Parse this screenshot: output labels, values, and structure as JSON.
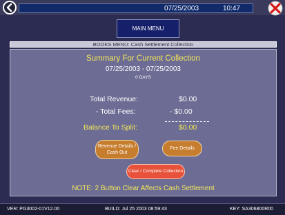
{
  "header": {
    "date": "07/25/2003",
    "time": "10:47"
  },
  "menu": {
    "main_menu_label": "MAIN MENU",
    "books_menu_label": "BOOKS MENU: Cash Settlement Collection"
  },
  "summary": {
    "title": "Summary For Current Collection",
    "date_range": "07/25/2003 - 07/25/2003",
    "days": "0 DAYS",
    "total_revenue_label": "Total Revenue:",
    "total_revenue_value": "$0.00",
    "total_fees_label": "- Total Fees:",
    "total_fees_value": "- $0.00",
    "balance_label": "Balance To Split:",
    "balance_value": "$0.00"
  },
  "buttons": {
    "revenue_details_line1": "Revenue Details /",
    "revenue_details_line2": "Cash Out",
    "fee_details": "Fee Details",
    "clear_collection": "Clear / Complete Collection"
  },
  "note": "NOTE: 2 Button Clear Affects Cash Settlement",
  "footer": {
    "version": "VER: PG3002-01V12.00",
    "build": "BUILD: Jul 25 2003 08:59:43",
    "key": "KEY: SA306800R00"
  },
  "colors": {
    "accent_yellow": "#f4e85a",
    "button_tan": "#c77d2e",
    "button_red": "#e8523a",
    "panel": "#6c6c94"
  },
  "icons": {
    "back": "back-arrow-icon",
    "close": "close-x-icon"
  }
}
